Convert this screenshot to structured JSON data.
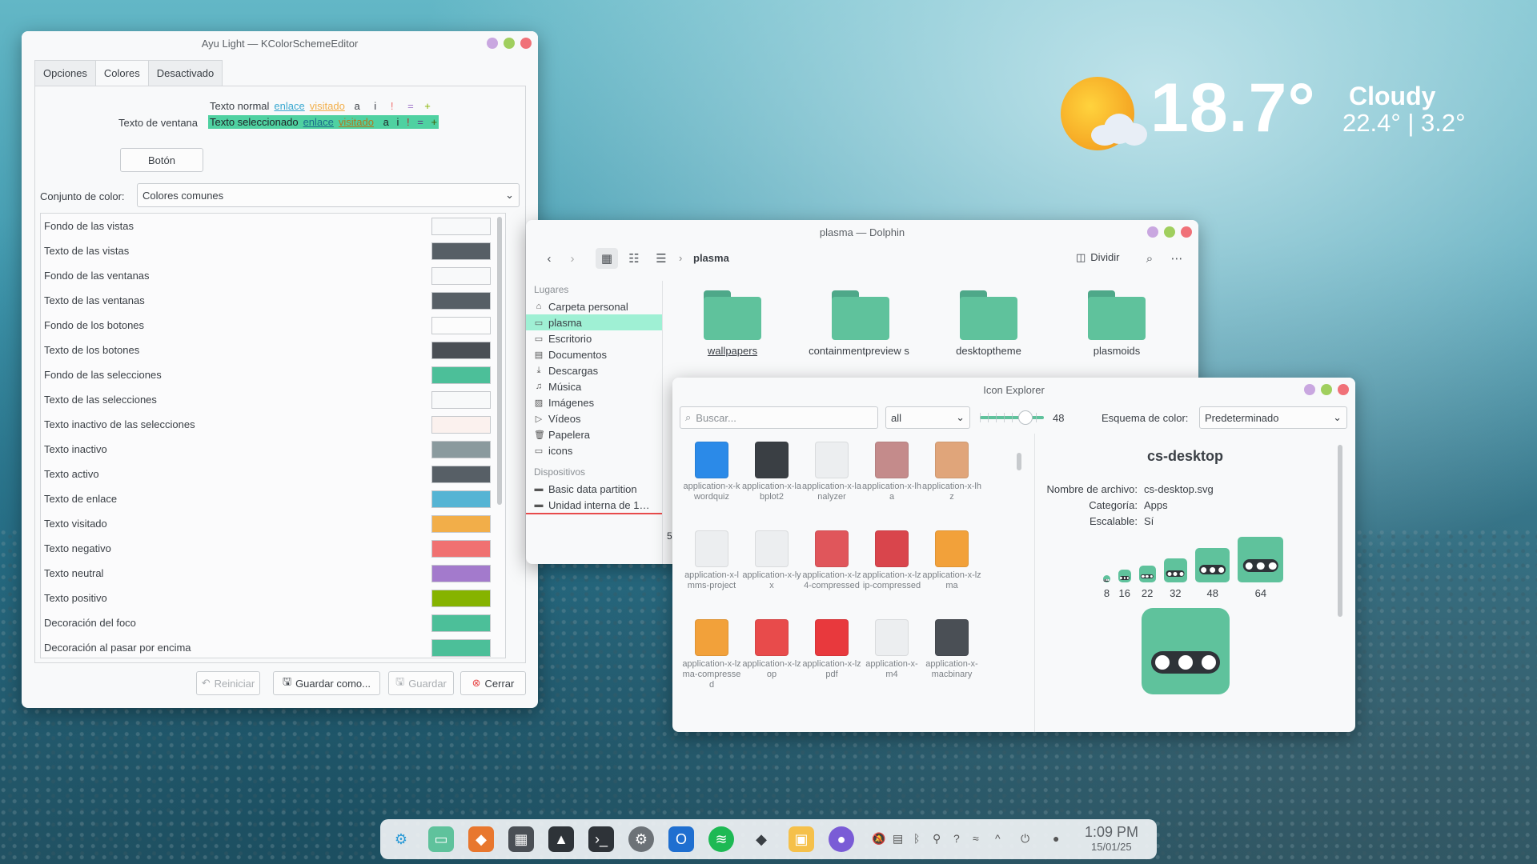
{
  "weather": {
    "temperature": "18.7°",
    "condition": "Cloudy",
    "range": "22.4° | 3.2°"
  },
  "kcolorscheme": {
    "title": "Ayu Light — KColorSchemeEditor",
    "tabs": [
      "Opciones",
      "Colores",
      "Desactivado"
    ],
    "preview": {
      "label": "Texto de ventana",
      "normal": "Texto normal",
      "selected": "Texto seleccionado",
      "link": "enlace",
      "visited": "visitado",
      "glyph_a": "a",
      "glyph_i": "i",
      "glyph_bang": "!",
      "glyph_eq": "=",
      "glyph_plus": "+"
    },
    "button_preview": "Botón",
    "color_set_label": "Conjunto de color:",
    "color_set_value": "Colores comunes",
    "colors": [
      {
        "label": "Fondo de las vistas",
        "color": "#f8f9fa"
      },
      {
        "label": "Texto de las vistas",
        "color": "#575f66"
      },
      {
        "label": "Fondo de las ventanas",
        "color": "#f8f9fa"
      },
      {
        "label": "Texto de las ventanas",
        "color": "#575f66"
      },
      {
        "label": "Fondo de los botones",
        "color": "#fcfcfc"
      },
      {
        "label": "Texto de los botones",
        "color": "#4a4f55"
      },
      {
        "label": "Fondo de las selecciones",
        "color": "#4cbf99"
      },
      {
        "label": "Texto de las selecciones",
        "color": "#f8f9fa"
      },
      {
        "label": "Texto inactivo de las selecciones",
        "color": "#fbf1ee"
      },
      {
        "label": "Texto inactivo",
        "color": "#8a9a9e"
      },
      {
        "label": "Texto activo",
        "color": "#575f66"
      },
      {
        "label": "Texto de enlace",
        "color": "#55b4d4"
      },
      {
        "label": "Texto visitado",
        "color": "#f2ae49"
      },
      {
        "label": "Texto negativo",
        "color": "#f07171"
      },
      {
        "label": "Texto neutral",
        "color": "#a37acc"
      },
      {
        "label": "Texto positivo",
        "color": "#86b300"
      },
      {
        "label": "Decoración del foco",
        "color": "#4cbf99"
      },
      {
        "label": "Decoración al pasar por encima",
        "color": "#4cbf99"
      }
    ],
    "footer": {
      "reset": "Reiniciar",
      "save_as": "Guardar como...",
      "save": "Guardar",
      "close": "Cerrar"
    }
  },
  "dolphin": {
    "title": "plasma — Dolphin",
    "breadcrumb": "plasma",
    "split": "Dividir",
    "places_header": "Lugares",
    "places": [
      "Carpeta personal",
      "plasma",
      "Escritorio",
      "Documentos",
      "Descargas",
      "Música",
      "Imágenes",
      "Vídeos",
      "Papelera",
      "icons"
    ],
    "devices_header": "Dispositivos",
    "devices": [
      "Basic data partition",
      "Unidad interna de 1…"
    ],
    "folders": [
      "wallpapers",
      "containmentpreview s",
      "desktoptheme",
      "plasmoids"
    ],
    "status_partial": "5"
  },
  "iconexplorer": {
    "title": "Icon Explorer",
    "search_placeholder": "Buscar...",
    "filter": "all",
    "size": "48",
    "scheme_label": "Esquema de color:",
    "scheme_value": "Predeterminado",
    "icons": [
      {
        "name": "application-x-kwordquiz",
        "color": "#2b8ae8"
      },
      {
        "name": "application-x-labplot2",
        "color": "#3a3f44"
      },
      {
        "name": "application-x-lanalyzer",
        "color": "#eceef0"
      },
      {
        "name": "application-x-lha",
        "color": "#c48b8b"
      },
      {
        "name": "application-x-lhz",
        "color": "#e0a57a"
      },
      {
        "name": "application-x-lmms-project",
        "color": "#eceef0"
      },
      {
        "name": "application-x-lyx",
        "color": "#eceef0"
      },
      {
        "name": "application-x-lz4-compressed",
        "color": "#e0565b"
      },
      {
        "name": "application-x-lzip-compressed",
        "color": "#d9454c"
      },
      {
        "name": "application-x-lzma",
        "color": "#f2a13a"
      },
      {
        "name": "application-x-lzma-compressed",
        "color": "#f2a13a"
      },
      {
        "name": "application-x-lzop",
        "color": "#e84b4b"
      },
      {
        "name": "application-x-lzpdf",
        "color": "#e8393d"
      },
      {
        "name": "application-x-m4",
        "color": "#eceef0"
      },
      {
        "name": "application-x-macbinary",
        "color": "#4a4f55"
      }
    ],
    "detail": {
      "name": "cs-desktop",
      "filename_label": "Nombre de archivo:",
      "filename": "cs-desktop.svg",
      "category_label": "Categoría:",
      "category": "Apps",
      "scalable_label": "Escalable:",
      "scalable": "Sí",
      "sizes": [
        "8",
        "16",
        "22",
        "32",
        "48",
        "64"
      ]
    }
  },
  "taskbar": {
    "time": "1:09 PM",
    "date": "15/01/25"
  }
}
